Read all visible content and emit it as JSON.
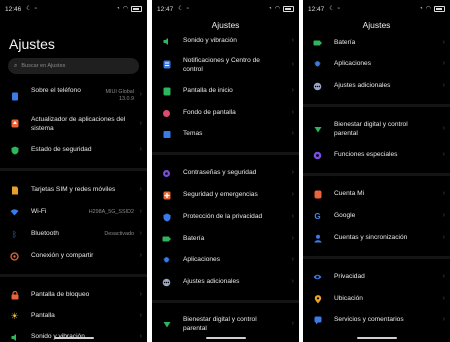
{
  "colors": {
    "background": "#000000",
    "text": "#eaeaea",
    "muted": "#8a8a8a",
    "chevron": "#4a4a4a"
  },
  "panel1": {
    "time": "12:46",
    "title": "Ajustes",
    "search_placeholder": "Buscar en Ajustes",
    "items": [
      {
        "label": "Sobre el teléfono",
        "value": "MIUI Global 13.0.9",
        "icon": "phone-icon"
      },
      {
        "label": "Actualizador de aplicaciones del sistema",
        "icon": "arrow-up-icon"
      },
      {
        "label": "Estado de seguridad",
        "icon": "shield-check-icon"
      },
      {
        "label": "Tarjetas SIM y redes móviles",
        "icon": "sim-card-icon"
      },
      {
        "label": "Wi-Fi",
        "value": "H298A_5G_SSID2",
        "icon": "wifi-icon"
      },
      {
        "label": "Bluetooth",
        "value": "Desactivado",
        "icon": "bluetooth-icon"
      },
      {
        "label": "Conexión y compartir",
        "icon": "share-icon"
      },
      {
        "label": "Pantalla de bloqueo",
        "icon": "lock-icon"
      },
      {
        "label": "Pantalla",
        "icon": "brightness-icon"
      },
      {
        "label": "Sonido y vibración",
        "icon": "speaker-icon"
      }
    ]
  },
  "panel2": {
    "time": "12:47",
    "title": "Ajustes",
    "items": [
      {
        "label": "Sonido y vibración",
        "icon": "speaker-icon"
      },
      {
        "label": "Notificaciones y Centro de control",
        "icon": "notification-icon"
      },
      {
        "label": "Pantalla de inicio",
        "icon": "home-icon"
      },
      {
        "label": "Fondo de pantalla",
        "icon": "wallpaper-icon"
      },
      {
        "label": "Temas",
        "icon": "theme-icon"
      },
      {
        "label": "Contraseñas y seguridad",
        "icon": "password-icon"
      },
      {
        "label": "Seguridad y emergencias",
        "icon": "emergency-icon"
      },
      {
        "label": "Protección de la privacidad",
        "icon": "privacy-icon"
      },
      {
        "label": "Batería",
        "icon": "battery-icon"
      },
      {
        "label": "Aplicaciones",
        "icon": "apps-icon"
      },
      {
        "label": "Ajustes adicionales",
        "icon": "more-icon"
      },
      {
        "label": "Bienestar digital y control parental",
        "icon": "wellbeing-icon"
      }
    ]
  },
  "panel3": {
    "time": "12:47",
    "title": "Ajustes",
    "items": [
      {
        "label": "Batería",
        "icon": "battery-icon"
      },
      {
        "label": "Aplicaciones",
        "icon": "apps-icon"
      },
      {
        "label": "Ajustes adicionales",
        "icon": "more-icon"
      },
      {
        "label": "Bienestar digital y control parental",
        "icon": "wellbeing-icon"
      },
      {
        "label": "Funciones especiales",
        "icon": "special-features-icon"
      },
      {
        "label": "Cuenta Mi",
        "icon": "mi-account-icon"
      },
      {
        "label": "Google",
        "icon": "google-icon"
      },
      {
        "label": "Cuentas y sincronización",
        "icon": "account-sync-icon"
      },
      {
        "label": "Privacidad",
        "icon": "eye-icon"
      },
      {
        "label": "Ubicación",
        "icon": "location-icon"
      },
      {
        "label": "Servicios y comentarios",
        "icon": "feedback-icon"
      }
    ]
  }
}
